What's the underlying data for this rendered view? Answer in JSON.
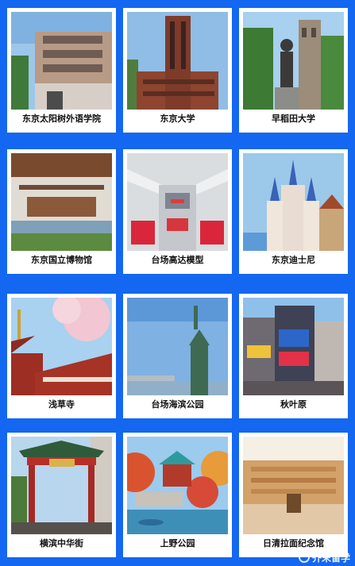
{
  "cards": [
    {
      "label": "东京太阳树外语学院"
    },
    {
      "label": "东京大学"
    },
    {
      "label": "早稻田大学"
    },
    {
      "label": "东京国立博物馆"
    },
    {
      "label": "台场高达模型"
    },
    {
      "label": "东京迪士尼"
    },
    {
      "label": "浅草寺"
    },
    {
      "label": "台场海滨公园"
    },
    {
      "label": "秋叶原"
    },
    {
      "label": "横滨中华街"
    },
    {
      "label": "上野公园"
    },
    {
      "label": "日清拉面纪念馆"
    }
  ],
  "watermark": {
    "text": "芥末留学"
  },
  "colors": {
    "background": "#1467f0",
    "card": "#ffffff"
  }
}
